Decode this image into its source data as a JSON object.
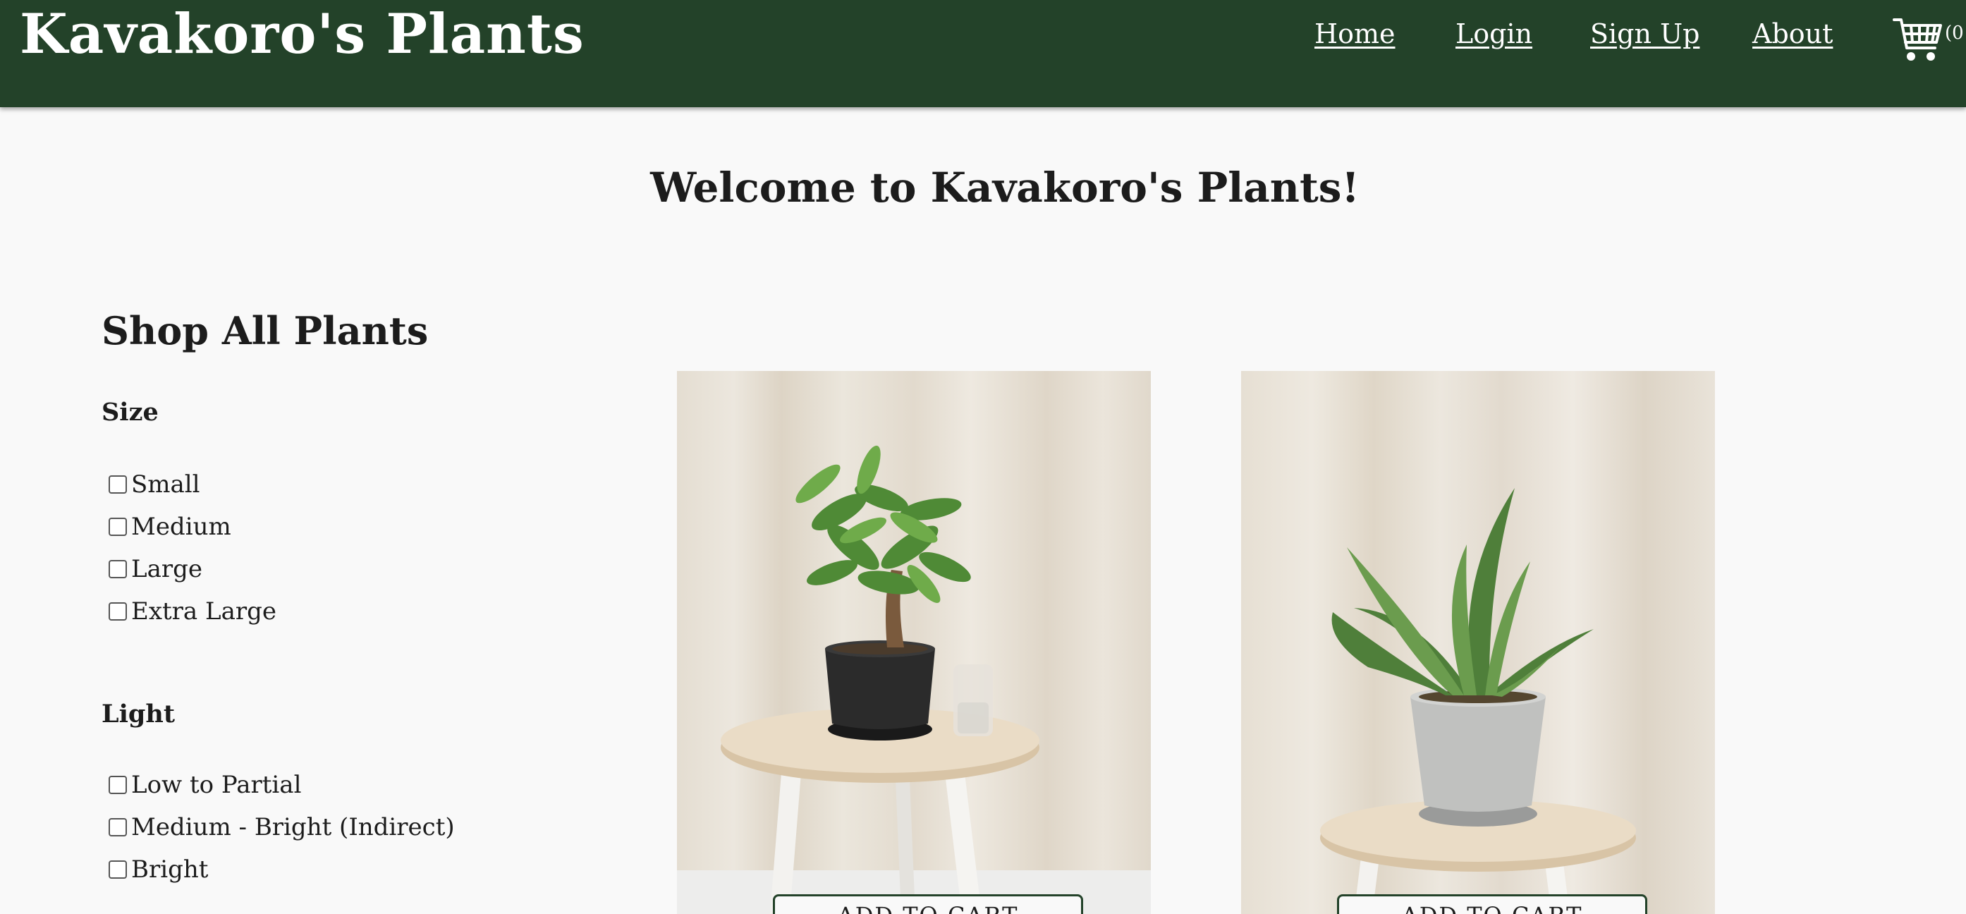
{
  "header": {
    "brand": "Kavakoro's Plants",
    "nav": {
      "home": "Home",
      "login": "Login",
      "signup": "Sign Up",
      "about": "About"
    },
    "cart_icon": "shopping-cart-icon",
    "cart_count": "(0",
    "bg_color": "#234229"
  },
  "main": {
    "welcome": "Welcome to Kavakoro's Plants!",
    "shop_title": "Shop All Plants"
  },
  "filters": {
    "size": {
      "title": "Size",
      "options": [
        "Small",
        "Medium",
        "Large",
        "Extra Large"
      ]
    },
    "light": {
      "title": "Light",
      "options": [
        "Low to Partial",
        "Medium - Bright (Indirect)",
        "Bright"
      ]
    }
  },
  "products": [
    {
      "image": "money-tree-plant-photo",
      "button": "ADD TO CART"
    },
    {
      "image": "snake-plant-photo",
      "button": "ADD TO CART"
    }
  ]
}
